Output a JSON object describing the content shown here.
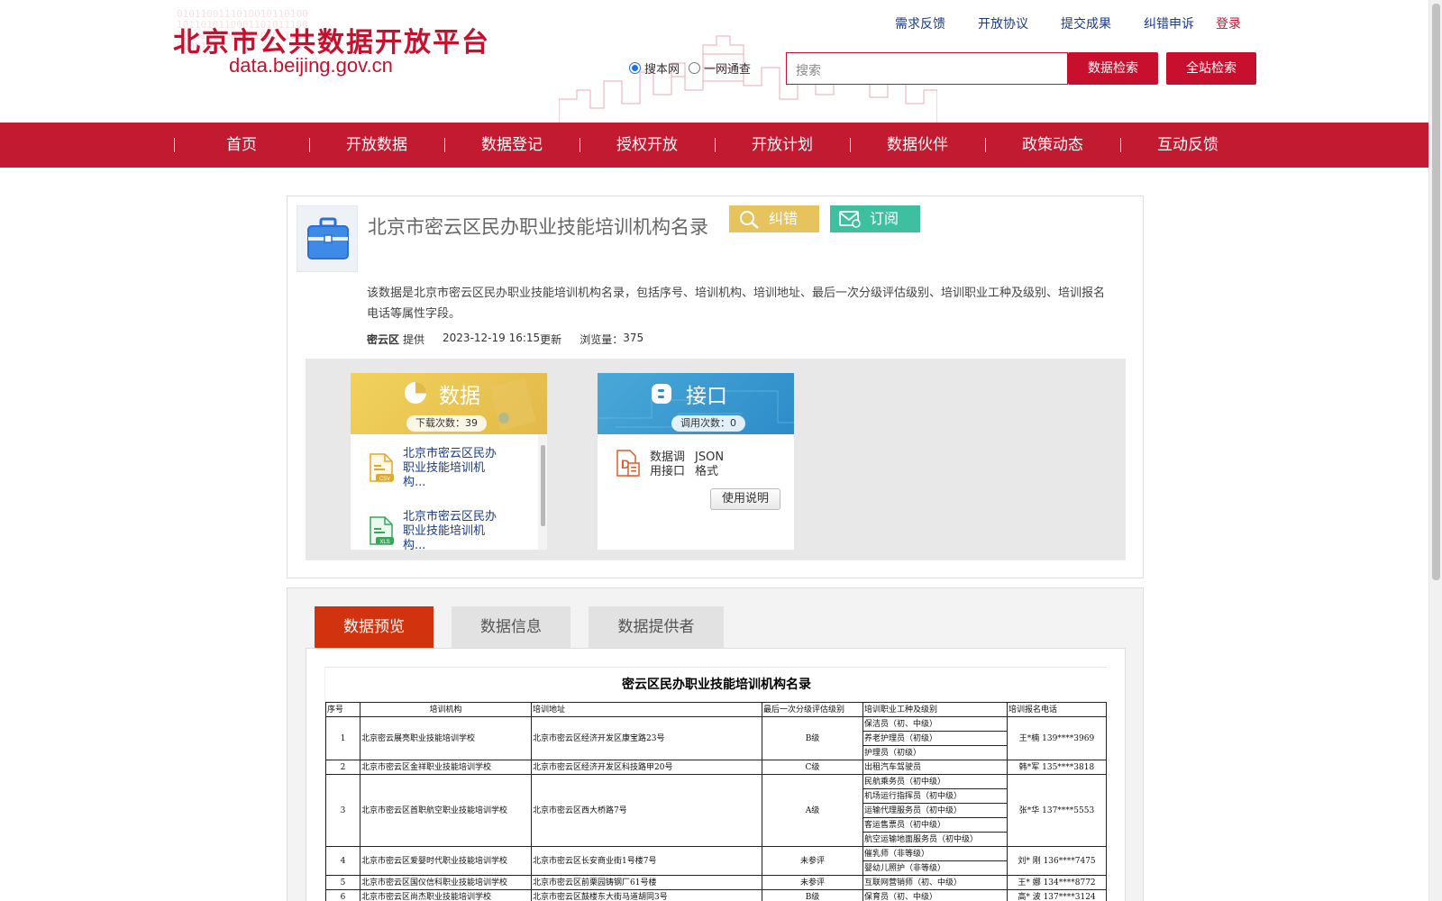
{
  "header": {
    "site_title": "北京市公共数据开放平台",
    "site_url": "data.beijing.gov.cn",
    "top_links": [
      "需求反馈",
      "开放协议",
      "提交成果",
      "纠错申诉"
    ],
    "login": "登录",
    "scope_options": [
      "搜本网",
      "一网通查"
    ],
    "search_placeholder": "搜索",
    "data_search_btn": "数据检索",
    "site_search_btn": "全站检索"
  },
  "nav": [
    "首页",
    "开放数据",
    "数据登记",
    "授权开放",
    "开放计划",
    "数据伙伴",
    "政策动态",
    "互动反馈"
  ],
  "dataset": {
    "title": "北京市密云区民办职业技能培训机构名录",
    "correct_btn": "纠错",
    "subscribe_btn": "订阅",
    "description": "该数据是北京市密云区民办职业技能培训机构名录，包括序号、培训机构、培训地址、最后一次分级评估级别、培训职业工种及级别、培训报名电话等属性字段。",
    "provider": "密云区",
    "provider_suffix": "提供",
    "updated": "2023-12-19 16:15",
    "updated_suffix": "更新",
    "views_label": "浏览量：",
    "views": "375"
  },
  "data_panel": {
    "title": "数据",
    "downloads_label": "下载次数：",
    "downloads": "39",
    "files": [
      {
        "name": "北京市密云区民办职业技能培训机构...",
        "format": "CSV"
      },
      {
        "name": "北京市密云区民办职业技能培训机构...",
        "format": "XLS"
      }
    ]
  },
  "api_panel": {
    "title": "接口",
    "calls_label": "调用次数：",
    "calls": "0",
    "api_name": "数据调用接口",
    "api_format": "JSON格式",
    "usage_btn": "使用说明"
  },
  "tabs": [
    "数据预览",
    "数据信息",
    "数据提供者"
  ],
  "preview": {
    "doc_title": "密云区民办职业技能培训机构名录",
    "headers": [
      "序号",
      "培训机构",
      "培训地址",
      "最后一次分级评估级别",
      "培训职业工种及级别",
      "培训报名电话"
    ],
    "rows": [
      {
        "no": "1",
        "org": "北京密云展亮职业技能培训学校",
        "addr": "北京市密云区经济开发区康宝路23号",
        "grade": "B级",
        "jobs": [
          "保洁员（初、中级）",
          "养老护理员（初级）",
          "护理员（初级）"
        ],
        "phone": "王*楠 139****3969"
      },
      {
        "no": "2",
        "org": "北京市密云区金祥职业技能培训学校",
        "addr": "北京市密云区经济开发区科技路甲20号",
        "grade": "C级",
        "jobs": [
          "出租汽车驾驶员"
        ],
        "phone": "韩*军 135****3818"
      },
      {
        "no": "3",
        "org": "北京市密云区首职航空职业技能培训学校",
        "addr": "北京市密云区西大桥路7号",
        "grade": "A级",
        "jobs": [
          "民航乘务员（初中级）",
          "机场运行指挥员（初中级）",
          "运输代理服务员（初中级）",
          "客运售票员（初中级）",
          "航空运输地面服务员（初中级）"
        ],
        "phone": "张*华 137****5553"
      },
      {
        "no": "4",
        "org": "北京市密云区爱婴时代职业技能培训学校",
        "addr": "北京市密云区长安商业街1号楼7号",
        "grade": "未参评",
        "jobs": [
          "催乳师（非等级）",
          "婴幼儿照护（非等级）"
        ],
        "phone": "刘* 刚 136****7475"
      },
      {
        "no": "5",
        "org": "北京市密云区国仪信科职业技能培训学校",
        "addr": "北京市密云区前栗园铸钢厂61号楼",
        "grade": "未参评",
        "jobs": [
          "互联网营销师（初、中级）"
        ],
        "phone": "王* 娜 134****8772"
      },
      {
        "no": "6",
        "org": "北京市密云区尚杰职业技能培训学校",
        "addr": "北京市密云区鼓楼东大街马道胡同3号",
        "grade": "B级",
        "jobs": [
          "保育员（初、中级）"
        ],
        "phone": "高* 波 137****3124"
      }
    ]
  },
  "colors": {
    "brand_red": "#c8102e",
    "nav_red": "#c21a30",
    "tab_active": "#d1330f",
    "correct_yellow": "#e6c35c",
    "subscribe_teal": "#3ebfa0"
  },
  "icons": {
    "dataset": "briefcase-icon",
    "correct": "magnifier-icon",
    "subscribe": "mail-icon",
    "data": "pie-chart-icon",
    "api": "api-icon",
    "csv": "csv-file-icon",
    "xls": "xls-file-icon",
    "doc": "document-icon"
  }
}
